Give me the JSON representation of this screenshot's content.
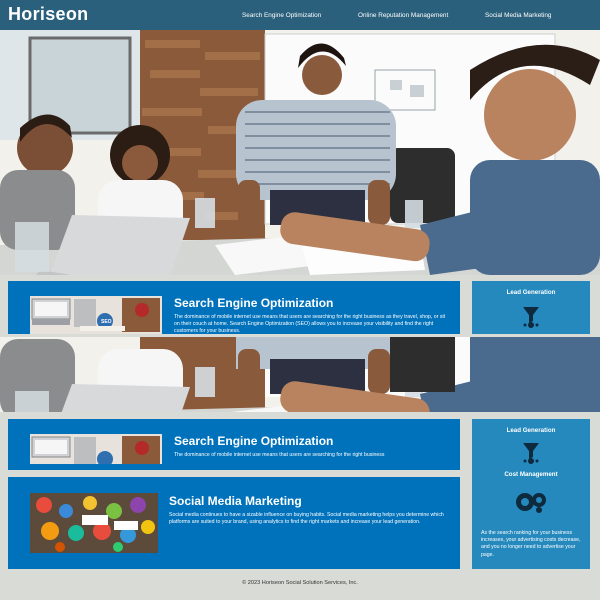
{
  "header": {
    "logo": "Horiseon",
    "nav": [
      {
        "label": "Search Engine Optimization"
      },
      {
        "label": "Online Reputation Management"
      },
      {
        "label": "Social Media Marketing"
      }
    ]
  },
  "content": {
    "seo": {
      "title": "Search Engine Optimization",
      "text": "The dominance of mobile internet use means that users are searching for the right business as they travel, shop, or sit on their couch at home. Search Engine Optimization (SEO) allows you to increase your visibility and find the right customers for your business.",
      "text_cropped": "The dominance of mobile internet use means that users are searching for the right business"
    },
    "social": {
      "title": "Social Media Marketing",
      "text": "Social media continues to have a sizable influence on buying habits. Social media marketing helps you determine which platforms are suited to your brand, using analytics to find the right markets and increase your lead generation."
    }
  },
  "benefits": {
    "lead": {
      "title": "Lead Generation"
    },
    "cost": {
      "title": "Cost Management",
      "text": "As the search ranking for your business increases, your advertising costs decrease, and you no longer need to advertise your page."
    }
  },
  "footer": {
    "text": "© 2023 Horiseon Social Solution Services, Inc."
  },
  "colors": {
    "header": "#2a607c",
    "card": "#0072bb",
    "side": "#2589bd",
    "page": "#d9dcd6"
  }
}
